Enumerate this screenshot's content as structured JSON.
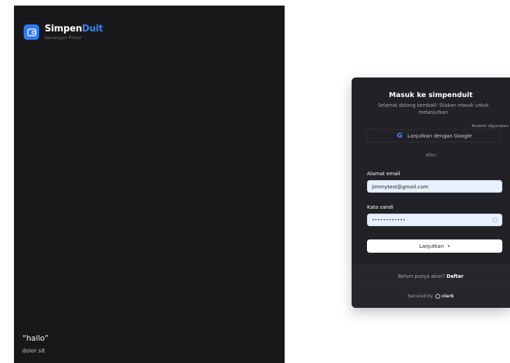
{
  "brand": {
    "name_primary": "Simpen",
    "name_accent": "Duit",
    "tagline": "Keuangan Pintar",
    "icon": "wallet-icon",
    "accent_color": "#3b82f6"
  },
  "quote": {
    "text": "“hallo”",
    "author": "dolor sit"
  },
  "signin": {
    "title": "Masuk ke simpenduit",
    "subtitle": "Selamat datang kembali! Silakan masuk untuk melanjutkan",
    "last_used_badge": "Terakhir digunakan",
    "google_button_label": "Lanjutkan dengan Google",
    "google_icon": "google-icon",
    "divider_text": "atau",
    "email_label": "Alamat email",
    "email_value": "jimmytest@gmail.com",
    "password_label": "Kata sandi",
    "password_value": "••••••••••••",
    "continue_label": "Lanjutkan",
    "continue_icon": "▸",
    "no_account_text": "Belum punya akun?",
    "signup_link": "Daftar",
    "secured_by": "Secured by",
    "provider": "clerk"
  }
}
